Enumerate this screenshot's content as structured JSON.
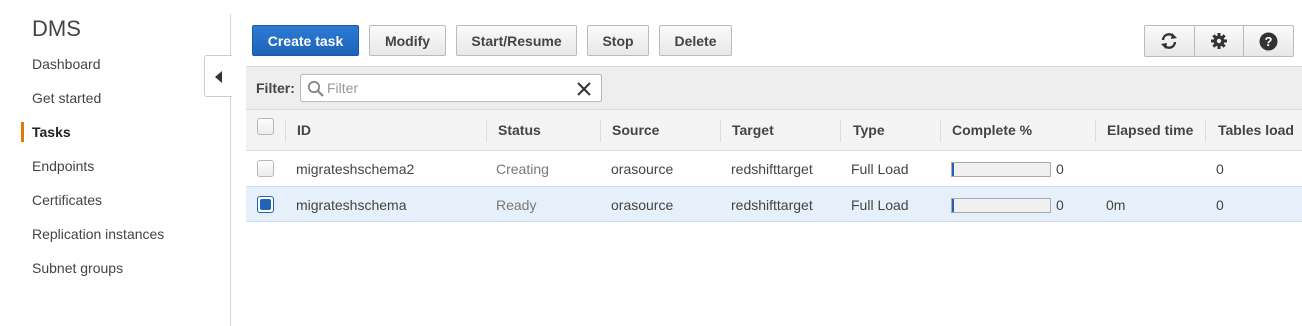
{
  "sidebar": {
    "title": "DMS",
    "items": [
      {
        "label": "Dashboard"
      },
      {
        "label": "Get started"
      },
      {
        "label": "Tasks",
        "active": true
      },
      {
        "label": "Endpoints"
      },
      {
        "label": "Certificates"
      },
      {
        "label": "Replication instances"
      },
      {
        "label": "Subnet groups"
      }
    ]
  },
  "toolbar": {
    "create_label": "Create task",
    "modify_label": "Modify",
    "start_label": "Start/Resume",
    "stop_label": "Stop",
    "delete_label": "Delete",
    "icons": [
      "refresh-icon",
      "gear-icon",
      "help-icon"
    ]
  },
  "filter": {
    "label": "Filter:",
    "placeholder": "Filter",
    "value": ""
  },
  "table": {
    "columns": [
      "ID",
      "Status",
      "Source",
      "Target",
      "Type",
      "Complete %",
      "Elapsed time",
      "Tables load"
    ],
    "rows": [
      {
        "id": "migrateshschema2",
        "status": "Creating",
        "source": "orasource",
        "target": "redshifttarget",
        "type": "Full Load",
        "complete": "0",
        "complete_pct": 0,
        "elapsed": "",
        "tables_loaded": "0",
        "selected": false
      },
      {
        "id": "migrateshschema",
        "status": "Ready",
        "source": "orasource",
        "target": "redshifttarget",
        "type": "Full Load",
        "complete": "0",
        "complete_pct": 0,
        "elapsed": "0m",
        "tables_loaded": "0",
        "selected": true
      }
    ]
  },
  "colors": {
    "primary": "#1e63b8",
    "active_accent": "#e07b00",
    "selected_row": "#e6f0fb"
  }
}
